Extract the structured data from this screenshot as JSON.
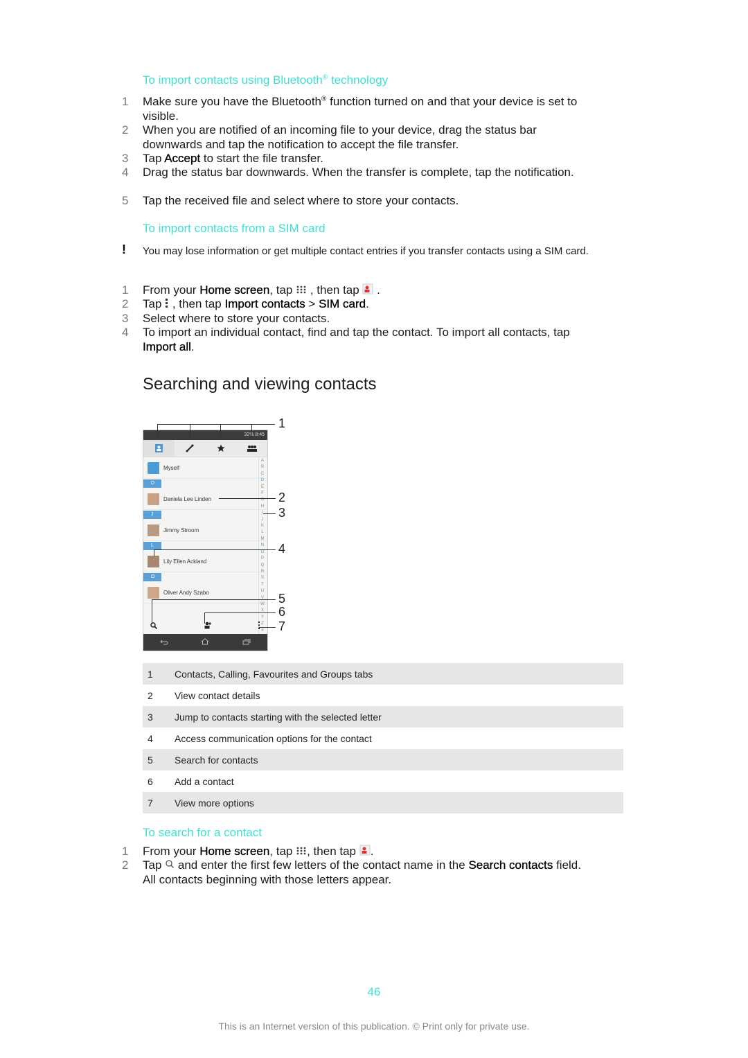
{
  "section_bluetooth": {
    "heading": "To import contacts using Bluetooth",
    "heading_sup": "®",
    "heading_tail": " technology",
    "steps": [
      {
        "num": "1",
        "parts": [
          "Make sure you have the Bluetooth",
          "®",
          " function turned on and that your device is set to visible."
        ]
      },
      {
        "num": "2",
        "text": "When you are notified of an incoming file to your device, drag the status bar downwards and tap the notification to accept the file transfer."
      },
      {
        "num": "3",
        "pre": "Tap ",
        "bold": "Accept",
        "post": " to start the file transfer."
      },
      {
        "num": "4",
        "text": "Drag the status bar downwards. When the transfer is complete, tap the notification."
      },
      {
        "num": "5",
        "text": "Tap the received file and select where to store your contacts."
      }
    ]
  },
  "section_sim": {
    "heading": "To import contacts from a SIM card",
    "warning_icon": "!",
    "warning": "You may lose information or get multiple contact entries if you transfer contacts using a SIM card.",
    "steps": [
      {
        "num": "1",
        "a": "From your ",
        "b": "Home screen",
        "c": ", tap ",
        "d": " , then tap ",
        "e": " ."
      },
      {
        "num": "2",
        "a": "Tap ",
        "b": " , then tap ",
        "c": "Import contacts",
        "d": " > ",
        "e": "SIM card",
        "f": "."
      },
      {
        "num": "3",
        "text": "Select where to store your contacts."
      },
      {
        "num": "4",
        "a": "To import an individual contact, find and tap the contact. To import all contacts, tap ",
        "b": "Import all",
        "c": "."
      }
    ]
  },
  "section_search_view": {
    "title": "Searching and viewing contacts",
    "phone": {
      "status_text": "32%  8:45",
      "tabs": [
        "contacts-tab",
        "calling-tab",
        "favourites-tab",
        "groups-tab"
      ],
      "contacts": [
        {
          "type": "contact",
          "name": "Myself"
        },
        {
          "type": "header",
          "letter": "D"
        },
        {
          "type": "contact",
          "name": "Daniela Lee Linden"
        },
        {
          "type": "header",
          "letter": "J"
        },
        {
          "type": "contact",
          "name": "Jimmy Stroom"
        },
        {
          "type": "header",
          "letter": "L"
        },
        {
          "type": "contact",
          "name": "Lily Ellen Ackland"
        },
        {
          "type": "header",
          "letter": "O"
        },
        {
          "type": "contact",
          "name": "Oliver Andy Szabo"
        }
      ],
      "index_letters": [
        "A",
        "B",
        "C",
        "D",
        "E",
        "F",
        "G",
        "H",
        "I",
        "J",
        "K",
        "L",
        "M",
        "N",
        "O",
        "P",
        "Q",
        "R",
        "S",
        "T",
        "U",
        "V",
        "W",
        "X",
        "Y",
        "Z",
        "#"
      ],
      "index_highlighted": [
        "D",
        "J",
        "L",
        "O"
      ]
    },
    "callouts": [
      "1",
      "2",
      "3",
      "4",
      "5",
      "6",
      "7"
    ],
    "key_table": [
      {
        "num": "1",
        "desc": "Contacts, Calling, Favourites and Groups tabs"
      },
      {
        "num": "2",
        "desc": "View contact details"
      },
      {
        "num": "3",
        "desc": "Jump to contacts starting with the selected letter"
      },
      {
        "num": "4",
        "desc": "Access communication options for the contact"
      },
      {
        "num": "5",
        "desc": "Search for contacts"
      },
      {
        "num": "6",
        "desc": "Add a contact"
      },
      {
        "num": "7",
        "desc": "View more options"
      }
    ]
  },
  "section_search": {
    "heading": "To search for a contact",
    "steps": [
      {
        "num": "1",
        "a": "From your ",
        "b": "Home screen",
        "c": ", tap ",
        "d": ", then tap ",
        "e": "."
      },
      {
        "num": "2",
        "a": "Tap ",
        "b": " and enter the first few letters of the contact name in the ",
        "c": "Search contacts",
        "d": " field. All contacts beginning with those letters appear."
      }
    ]
  },
  "page_number": "46",
  "footer": "This is an Internet version of this publication. © Print only for private use.",
  "colors": {
    "heading_accent": "#3de0d0",
    "table_stripe": "#e6e6e6",
    "index_highlight": "#4a9ad8"
  }
}
